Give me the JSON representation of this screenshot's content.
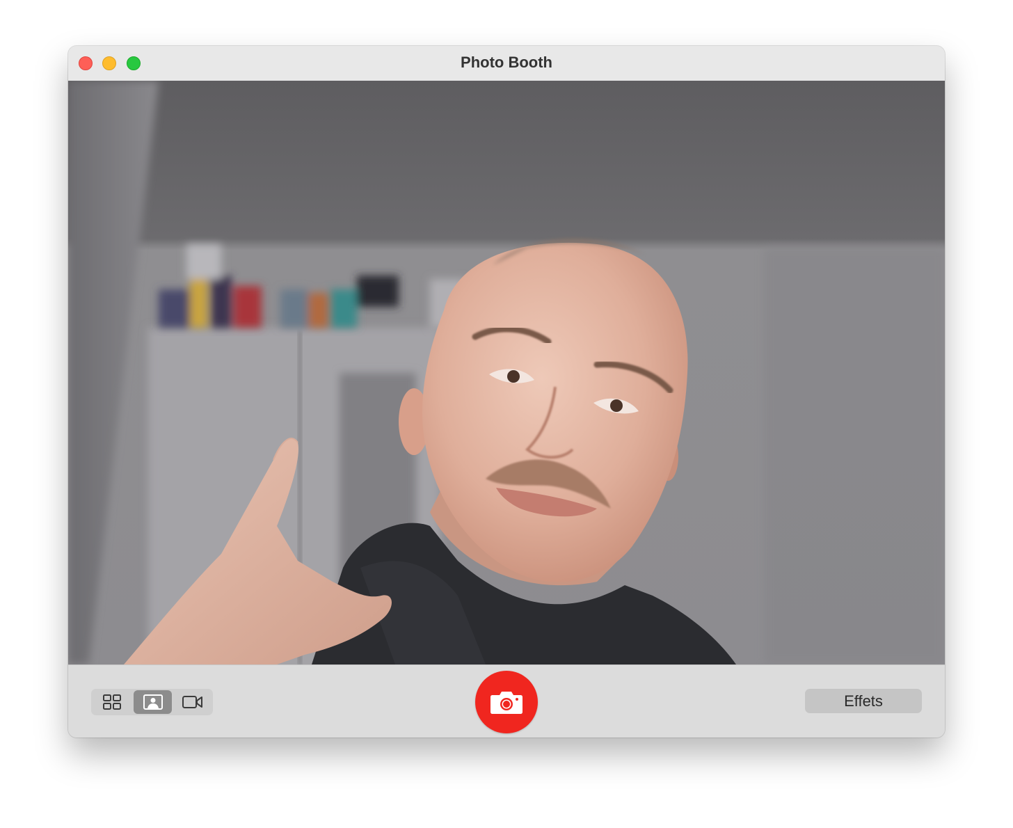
{
  "window": {
    "title": "Photo Booth"
  },
  "traffic_lights": {
    "close": "#fe5f57",
    "minimize": "#febc2e",
    "zoom": "#28c840"
  },
  "toolbar": {
    "modes": [
      {
        "icon": "grid-four-icon",
        "selected": false
      },
      {
        "icon": "single-photo-icon",
        "selected": true
      },
      {
        "icon": "video-camera-icon",
        "selected": false
      }
    ],
    "shutter_icon": "camera-icon",
    "shutter_color": "#f0261f",
    "effects_label": "Effets"
  }
}
